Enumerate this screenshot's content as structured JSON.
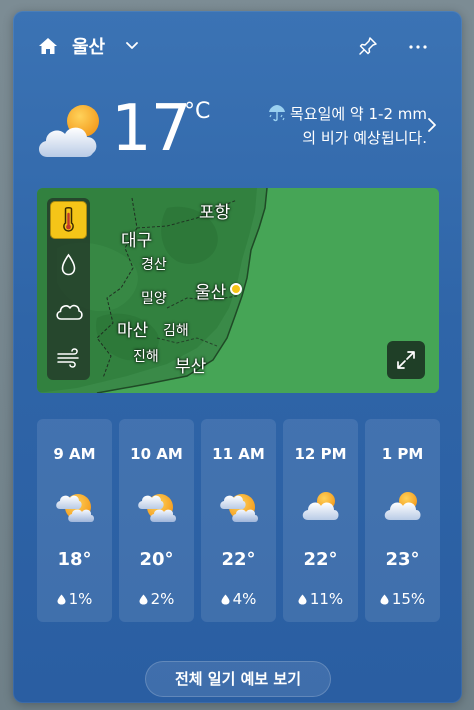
{
  "header": {
    "location": "울산"
  },
  "current": {
    "temperature": "17",
    "unit": "°C",
    "summary_line1": "목요일에 약 1-2 mm",
    "summary_line2": "의 비가 예상됩니다."
  },
  "map": {
    "cities": {
      "pohang": "포항",
      "daegu": "대구",
      "gyeongsan": "경산",
      "ulsan": "울산",
      "miryang": "밀양",
      "masan": "마산",
      "gimhae": "김해",
      "jinhae": "진해",
      "busan": "부산"
    },
    "layers": [
      "temperature",
      "precipitation",
      "cloud",
      "wind"
    ],
    "active_layer": "temperature"
  },
  "hourly": [
    {
      "time": "9 AM",
      "temp": "18°",
      "precip": "1%",
      "icon": "partly-sunny-icon"
    },
    {
      "time": "10 AM",
      "temp": "20°",
      "precip": "2%",
      "icon": "partly-sunny-icon"
    },
    {
      "time": "11 AM",
      "temp": "22°",
      "precip": "4%",
      "icon": "partly-sunny-icon"
    },
    {
      "time": "12 PM",
      "temp": "22°",
      "precip": "11%",
      "icon": "mostly-cloudy-icon"
    },
    {
      "time": "1 PM",
      "temp": "23°",
      "precip": "15%",
      "icon": "mostly-cloudy-icon"
    }
  ],
  "footer": {
    "full_forecast_label": "전체 일기 예보 보기"
  },
  "colors": {
    "card": "#2f65a8",
    "accent_sun": "#f5a623",
    "active_layer": "#f5c518",
    "map_land": "#3f9a4f"
  }
}
